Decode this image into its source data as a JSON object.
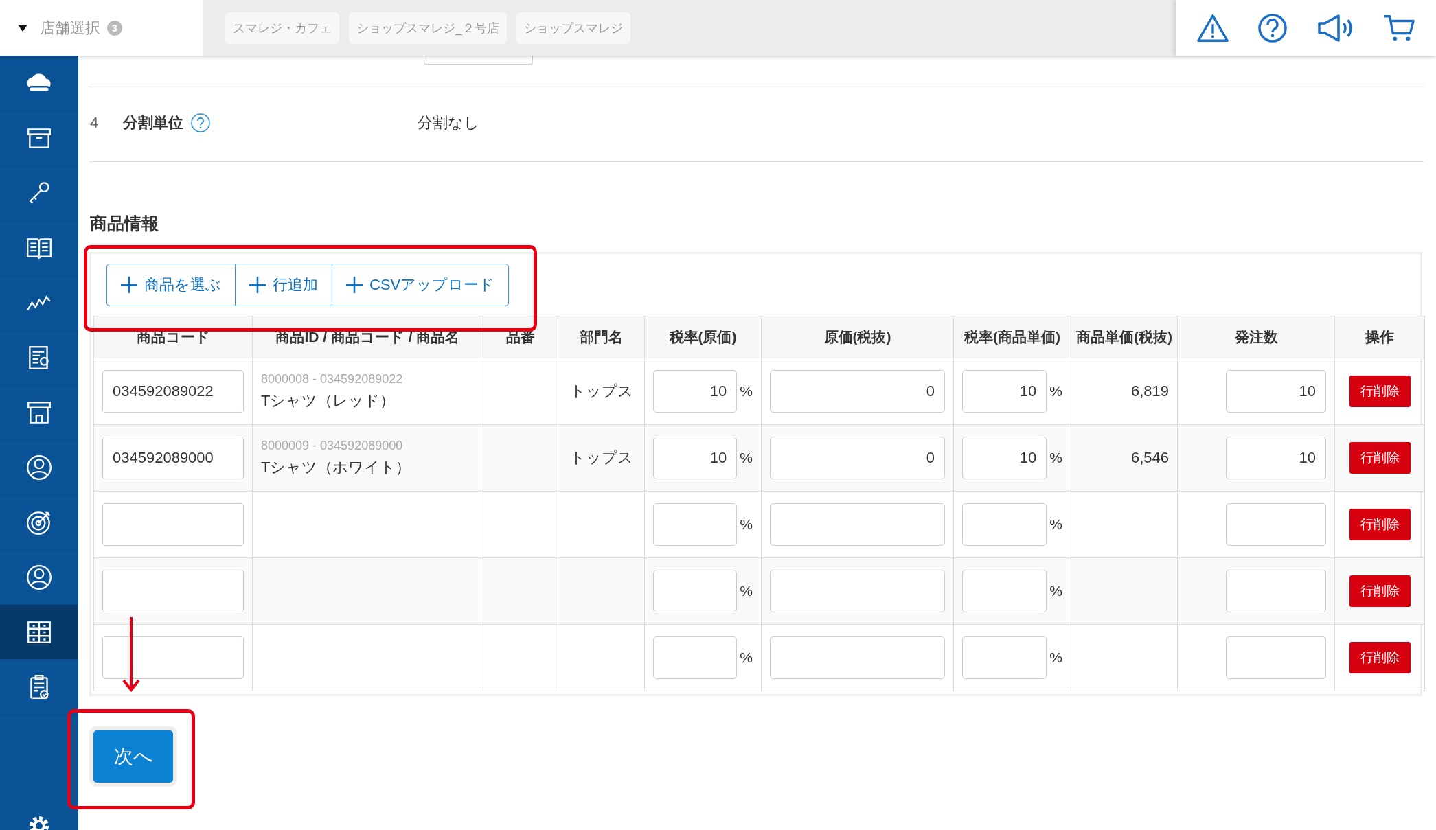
{
  "header": {
    "store_select_label": "店舗選択",
    "store_count": "3",
    "stores": [
      "スマレジ・カフェ",
      "ショップスマレジ_２号店",
      "ショップスマレジ"
    ]
  },
  "sidebar": {
    "items": [
      {
        "selected": false
      },
      {
        "selected": false
      },
      {
        "selected": false
      },
      {
        "selected": false
      },
      {
        "selected": false
      },
      {
        "selected": false
      },
      {
        "selected": false
      },
      {
        "selected": false
      },
      {
        "selected": false
      },
      {
        "selected": false
      },
      {
        "selected": true
      },
      {
        "selected": false
      }
    ]
  },
  "settings_rows": [
    {
      "number": "4",
      "label": "分割単位",
      "value": "分割なし"
    }
  ],
  "section_title": "商品情報",
  "toolbar": [
    "商品を選ぶ",
    "行追加",
    "CSVアップロード"
  ],
  "table": {
    "columns": [
      "商品コード",
      "商品ID / 商品コード / 商品名",
      "品番",
      "部門名",
      "税率(原価)",
      "原価(税抜)",
      "税率(商品単価)",
      "商品単価(税抜)",
      "発注数",
      "操作"
    ],
    "rows": [
      {
        "code": "034592089022",
        "product_id": "8000008 - 034592089022",
        "product_name": "Tシャツ（レッド）",
        "department": "トップス",
        "tax_cost": "10",
        "percent_cost": "%",
        "cost": "0",
        "tax_price": "10",
        "percent_price": "%",
        "unit_price": "6,819",
        "order_qty": "10",
        "action": "行削除"
      },
      {
        "code": "034592089000",
        "product_id": "8000009 - 034592089000",
        "product_name": "Tシャツ（ホワイト）",
        "department": "トップス",
        "tax_cost": "10",
        "percent_cost": "%",
        "cost": "0",
        "tax_price": "10",
        "percent_price": "%",
        "unit_price": "6,546",
        "order_qty": "10",
        "action": "行削除"
      },
      {
        "percent_cost": "%",
        "percent_price": "%",
        "action": "行削除"
      },
      {
        "percent_cost": "%",
        "percent_price": "%",
        "action": "行削除"
      },
      {
        "percent_cost": "%",
        "percent_price": "%",
        "action": "行削除"
      }
    ]
  },
  "next_button": "次へ"
}
